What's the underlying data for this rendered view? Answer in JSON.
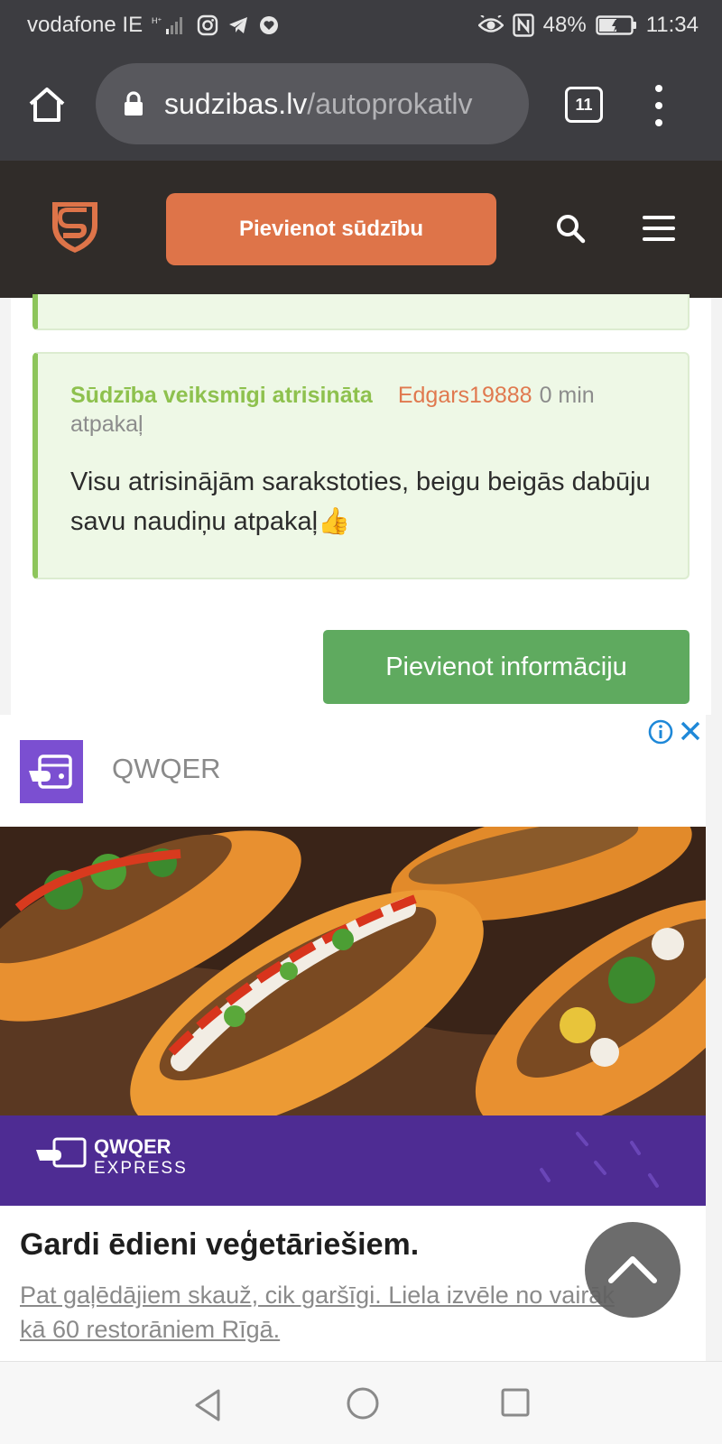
{
  "status_bar": {
    "carrier": "vodafone IE",
    "battery": "48%",
    "time": "11:34",
    "icons": [
      "signal-icon",
      "instagram-icon",
      "telegram-icon",
      "heart-message-icon",
      "eye-icon",
      "nfc-icon",
      "battery-icon"
    ]
  },
  "browser": {
    "url_domain": "sudzibas.lv",
    "url_path": "/autoprokatlv",
    "tab_count": "11"
  },
  "site": {
    "add_complaint_label": "Pievienot sūdzību",
    "accent": "#de7449",
    "header_bg": "#302c29"
  },
  "comment": {
    "status": "Sūdzība veiksmīgi atrisināta",
    "author": "Edgars19888",
    "time": "0 min atpakaļ",
    "text": "Visu atrisinājām sarakstoties, beigu beigās dabūju savu naudiņu atpakaļ👍",
    "status_color": "#8ec14e"
  },
  "actions": {
    "add_info_label": "Pievienot informāciju",
    "button_color": "#5faa5f"
  },
  "ad": {
    "brand": "QWQER",
    "banner_brand": "QWQER",
    "banner_sub": "EXPRESS",
    "headline": "Gardi ēdieni veģetāriešiem.",
    "description": "Pat gaļēdājiem skauž, cik garšīgi. Liela izvēle no vairāk kā 60 restorāniem Rīgā.",
    "brand_color": "#7b4fd1"
  }
}
